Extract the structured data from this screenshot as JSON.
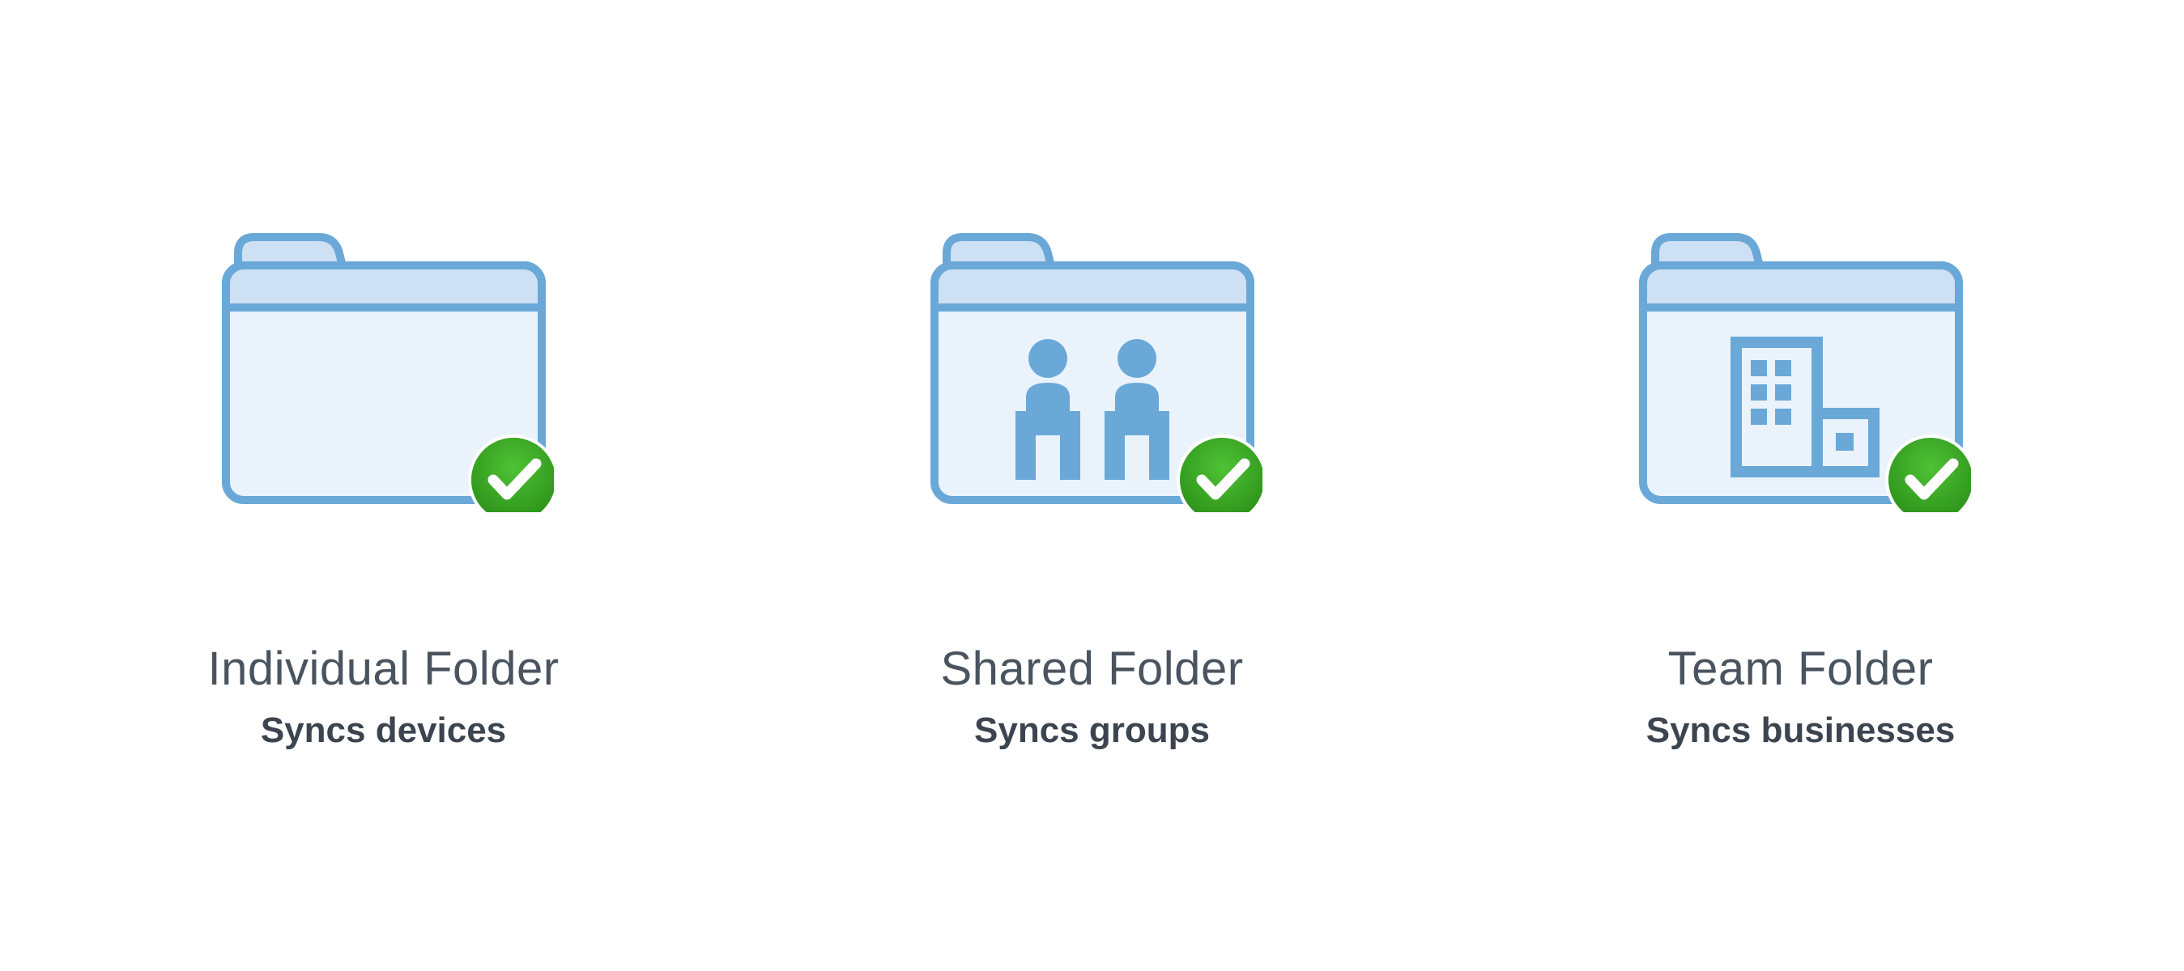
{
  "cards": [
    {
      "icon": "folder-individual-icon",
      "title": "Individual Folder",
      "subtitle": "Syncs devices"
    },
    {
      "icon": "folder-shared-icon",
      "title": "Shared Folder",
      "subtitle": "Syncs groups"
    },
    {
      "icon": "folder-team-icon",
      "title": "Team Folder",
      "subtitle": "Syncs businesses"
    }
  ],
  "colors": {
    "stroke": "#6aa8d8",
    "fill_light": "#eaf3fc",
    "fill_tab": "#cde0f4",
    "accent": "#6aa8d8",
    "check_green": "#2f9e1f",
    "check_green2": "#44b52f"
  }
}
